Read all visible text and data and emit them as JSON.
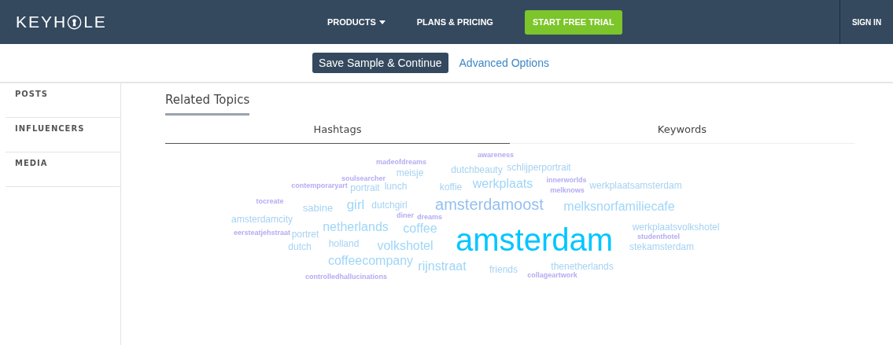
{
  "header": {
    "logo_parts": [
      "KEYH",
      "LE"
    ],
    "nav": [
      {
        "label": "PRODUCTS",
        "kind": "dropdown"
      },
      {
        "label": "PLANS & PRICING",
        "kind": "link"
      },
      {
        "label": "START FREE TRIAL",
        "kind": "cta"
      }
    ],
    "sign_in": "SIGN IN"
  },
  "actions": {
    "save": "Save Sample & Continue",
    "advanced": "Advanced Options"
  },
  "sidebar": {
    "items": [
      {
        "label": "POSTS"
      },
      {
        "label": "INFLUENCERS"
      },
      {
        "label": "MEDIA"
      }
    ]
  },
  "section_title": "Related Topics",
  "tabs": [
    {
      "label": "Hashtags",
      "selected": true
    },
    {
      "label": "Keywords",
      "selected": false
    }
  ],
  "cloud": [
    {
      "text": "madeofdreams",
      "color": "#b4acf2"
    },
    {
      "text": "awareness",
      "color": "#b4acf2"
    },
    {
      "text": "soulsearcher",
      "color": "#b4acf2"
    },
    {
      "text": "meisje",
      "color": "#a6d2f2"
    },
    {
      "text": "dutchbeauty",
      "color": "#a6d2f2"
    },
    {
      "text": "schlijperportrait",
      "color": "#a6d2f2"
    },
    {
      "text": "innerworlds",
      "color": "#b4acf2"
    },
    {
      "text": "contemporaryart",
      "color": "#b4acf2"
    },
    {
      "text": "portrait",
      "color": "#a6d2f2"
    },
    {
      "text": "lunch",
      "color": "#a6d2f2"
    },
    {
      "text": "koffie",
      "color": "#a6d2f2"
    },
    {
      "text": "werkplaats",
      "color": "#9fd6f8"
    },
    {
      "text": "melknows",
      "color": "#b4acf2"
    },
    {
      "text": "werkplaatsamsterdam",
      "color": "#a6d2f2"
    },
    {
      "text": "tocreate",
      "color": "#b4acf2"
    },
    {
      "text": "sabine",
      "color": "#a6d2f2"
    },
    {
      "text": "girl",
      "color": "#9fd6f8"
    },
    {
      "text": "dutchgirl",
      "color": "#a6d2f2"
    },
    {
      "text": "amsterdamoost",
      "color": "#94bff0"
    },
    {
      "text": "melksnorfamiliecafe",
      "color": "#9fd6f8"
    },
    {
      "text": "amsterdamcity",
      "color": "#a6d2f2"
    },
    {
      "text": "diner",
      "color": "#b4acf2"
    },
    {
      "text": "dreams",
      "color": "#b4acf2"
    },
    {
      "text": "eersteatjehstraat",
      "color": "#b4acf2"
    },
    {
      "text": "portret",
      "color": "#a6d2f2"
    },
    {
      "text": "netherlands",
      "color": "#9fd6f8"
    },
    {
      "text": "coffee",
      "color": "#9fd6f8"
    },
    {
      "text": "amsterdam",
      "color": "#00c6ff"
    },
    {
      "text": "werkplaatsvolkshotel",
      "color": "#a6d2f2"
    },
    {
      "text": "studenthotel",
      "color": "#b4acf2"
    },
    {
      "text": "dutch",
      "color": "#a6d2f2"
    },
    {
      "text": "holland",
      "color": "#a6d2f2"
    },
    {
      "text": "volkshotel",
      "color": "#9fd6f8"
    },
    {
      "text": "stekamsterdam",
      "color": "#a6d2f2"
    },
    {
      "text": "controlledhallucinations",
      "color": "#b4acf2"
    },
    {
      "text": "coffeecompany",
      "color": "#9fd6f8"
    },
    {
      "text": "rijnstraat",
      "color": "#9fd6f8"
    },
    {
      "text": "friends",
      "color": "#a6d2f2"
    },
    {
      "text": "thenetherlands",
      "color": "#a6d2f2"
    },
    {
      "text": "collageartwork",
      "color": "#b4acf2"
    }
  ]
}
